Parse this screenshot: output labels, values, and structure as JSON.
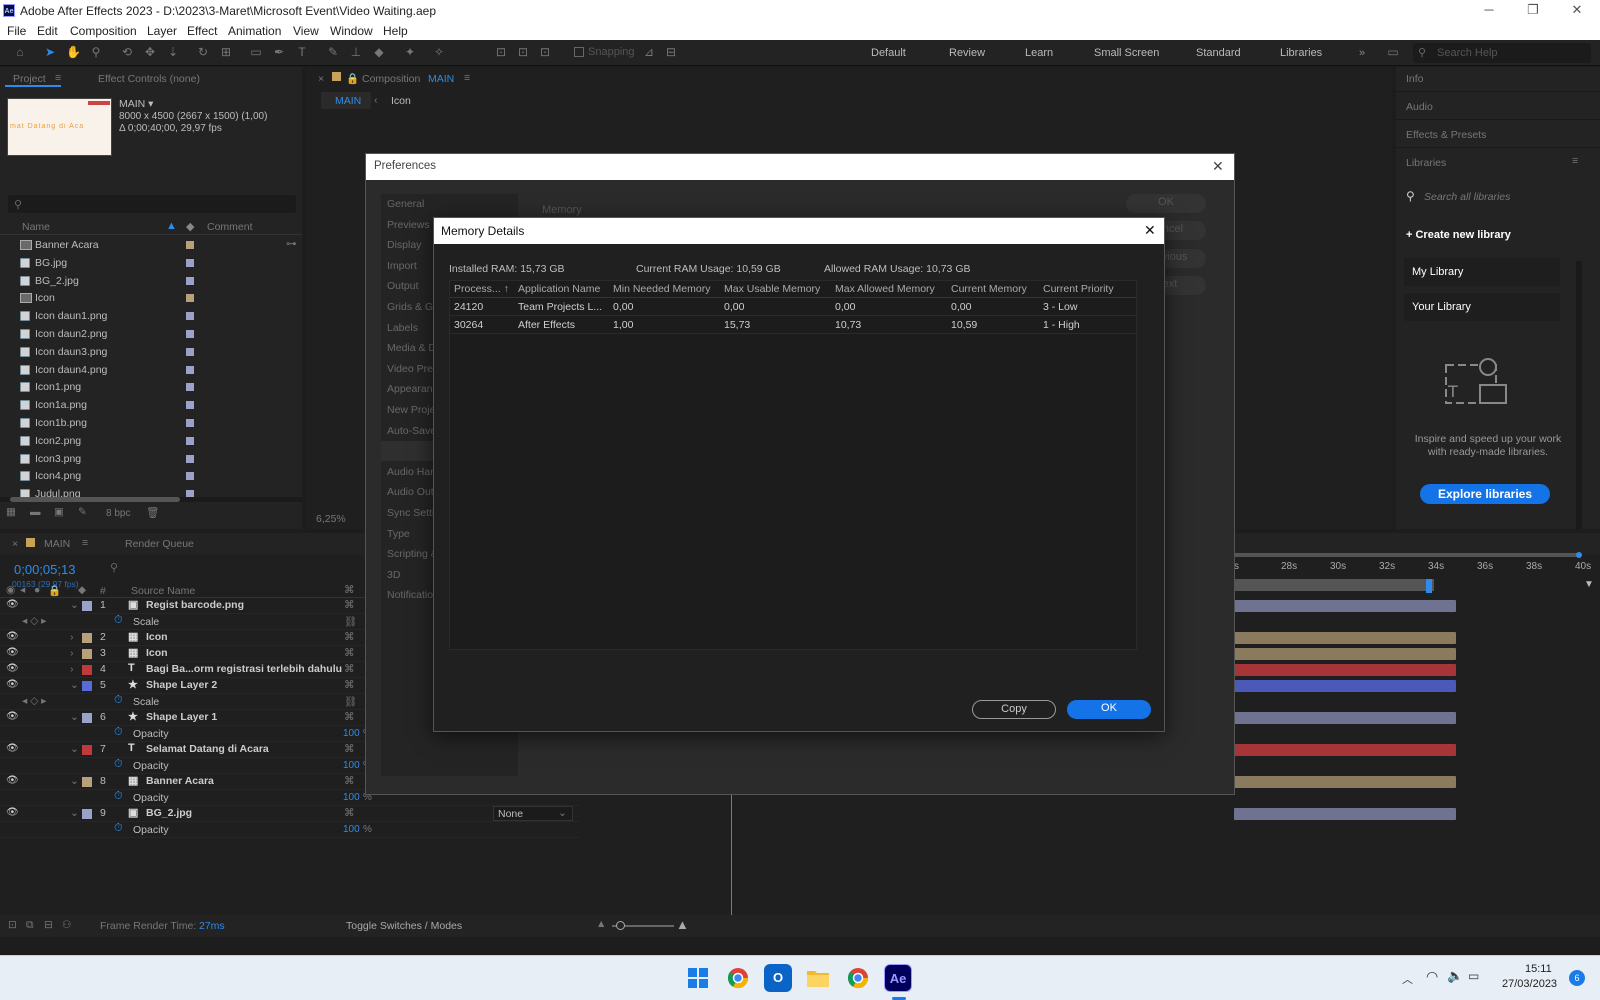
{
  "window": {
    "title": "Adobe After Effects 2023 - D:\\2023\\3-Maret\\Microsoft Event\\Video Waiting.aep",
    "app_badge": "Ae"
  },
  "menu": [
    "File",
    "Edit",
    "Composition",
    "Layer",
    "Effect",
    "Animation",
    "View",
    "Window",
    "Help"
  ],
  "workspaces": [
    "Default",
    "Review",
    "Learn",
    "Small Screen",
    "Standard",
    "Libraries"
  ],
  "toolbar": {
    "snapping": "Snapping",
    "search_help": "Search Help"
  },
  "project": {
    "tabs": [
      "Project",
      "Effect Controls (none)"
    ],
    "comp_name": "MAIN ▾",
    "comp_info1": "8000 x 4500  (2667 x 1500) (1,00)",
    "comp_info2": "Δ 0;00;40;00, 29,97 fps",
    "thumb_text": "mat Datang di Aca",
    "col_name": "Name",
    "col_comment": "Comment",
    "items": [
      "Banner Acara",
      "BG.jpg",
      "BG_2.jpg",
      "Icon",
      "Icon daun1.png",
      "Icon daun2.png",
      "Icon daun3.png",
      "Icon daun4.png",
      "Icon1.png",
      "Icon1a.png",
      "Icon1b.png",
      "Icon2.png",
      "Icon3.png",
      "Icon4.png",
      "Judul.png"
    ],
    "bpc": "8 bpc"
  },
  "comp_viewer": {
    "tab_prefix": "Composition",
    "tab_name": "MAIN",
    "crumb1": "MAIN",
    "crumb2": "Icon",
    "zoom": "6,25%"
  },
  "right_panel": {
    "items": [
      "Info",
      "Audio",
      "Effects & Presets",
      "Libraries"
    ],
    "search_placeholder": "Search all libraries",
    "create_library": "Create new library",
    "my_library": "My Library",
    "your_library": "Your Library",
    "promo_text": "Inspire and speed up your work with ready-made libraries.",
    "explore": "Explore libraries"
  },
  "preferences": {
    "title": "Preferences",
    "categories": [
      "General",
      "Previews",
      "Display",
      "Import",
      "Output",
      "Grids & Gu",
      "Labels",
      "Media & D",
      "Video Prev",
      "Appearanc",
      "New Proje",
      "Auto-Save",
      "",
      "Audio Har",
      "Audio Out",
      "Sync Settin",
      "Type",
      "Scripting &",
      "3D",
      "Notificatio"
    ],
    "section": "Memory",
    "buttons": [
      "OK",
      "Cancel",
      "Previous",
      "Next"
    ]
  },
  "memory_details": {
    "title": "Memory Details",
    "installed_ram": "Installed RAM: 15,73 GB",
    "current_ram": "Current RAM Usage: 10,59 GB",
    "allowed_ram": "Allowed RAM Usage: 10,73 GB",
    "columns": [
      "Process... ↑",
      "Application Name",
      "Min Needed Memory",
      "Max Usable Memory",
      "Max Allowed Memory",
      "Current Memory",
      "Current Priority"
    ],
    "rows": [
      [
        "24120",
        "Team Projects L...",
        "0,00",
        "0,00",
        "0,00",
        "0,00",
        "3 - Low"
      ],
      [
        "30264",
        "After Effects",
        "1,00",
        "15,73",
        "10,73",
        "10,59",
        "1 - High"
      ]
    ],
    "copy": "Copy",
    "ok": "OK"
  },
  "timeline": {
    "tab": "MAIN",
    "render_queue": "Render Queue",
    "timecode": "0;00;05;13",
    "frame_info": "00163 (29.97 fps)",
    "col_source": "Source Name",
    "col_num": "#",
    "ruler": [
      "28s",
      "30s",
      "32s",
      "34s",
      "36s",
      "38s",
      "40s"
    ],
    "ruler_first": "s",
    "layers": [
      {
        "num": "1",
        "name": "Regist barcode.png",
        "color": "#9aa2c8"
      },
      {
        "num": "",
        "name": "Scale",
        "color": ""
      },
      {
        "num": "2",
        "name": "Icon",
        "color": "#b8a07a"
      },
      {
        "num": "3",
        "name": "Icon",
        "color": "#b8a07a"
      },
      {
        "num": "4",
        "name": "Bagi Ba...orm registrasi terlebih dahulu",
        "color": "#c0393b"
      },
      {
        "num": "5",
        "name": "Shape Layer 2",
        "color": "#5a6ad8"
      },
      {
        "num": "",
        "name": "Scale",
        "color": ""
      },
      {
        "num": "6",
        "name": "Shape Layer 1",
        "color": "#9aa2c8"
      },
      {
        "num": "",
        "name": "Opacity",
        "color": ""
      },
      {
        "num": "7",
        "name": "Selamat Datang di Acara",
        "color": "#c0393b"
      },
      {
        "num": "",
        "name": "Opacity",
        "color": ""
      },
      {
        "num": "8",
        "name": "Banner Acara",
        "color": "#b8a07a"
      },
      {
        "num": "",
        "name": "Opacity",
        "color": ""
      },
      {
        "num": "9",
        "name": "BG_2.jpg",
        "color": "#9aa2c8"
      },
      {
        "num": "",
        "name": "Opacity",
        "color": ""
      }
    ],
    "values": {
      "pct": "100",
      "unit": "%",
      "none": "None"
    },
    "footer_label": "Frame Render Time:",
    "footer_value": "27ms",
    "toggle": "Toggle Switches / Modes"
  },
  "taskbar": {
    "time": "15:11",
    "date": "27/03/2023",
    "badge": "6"
  }
}
